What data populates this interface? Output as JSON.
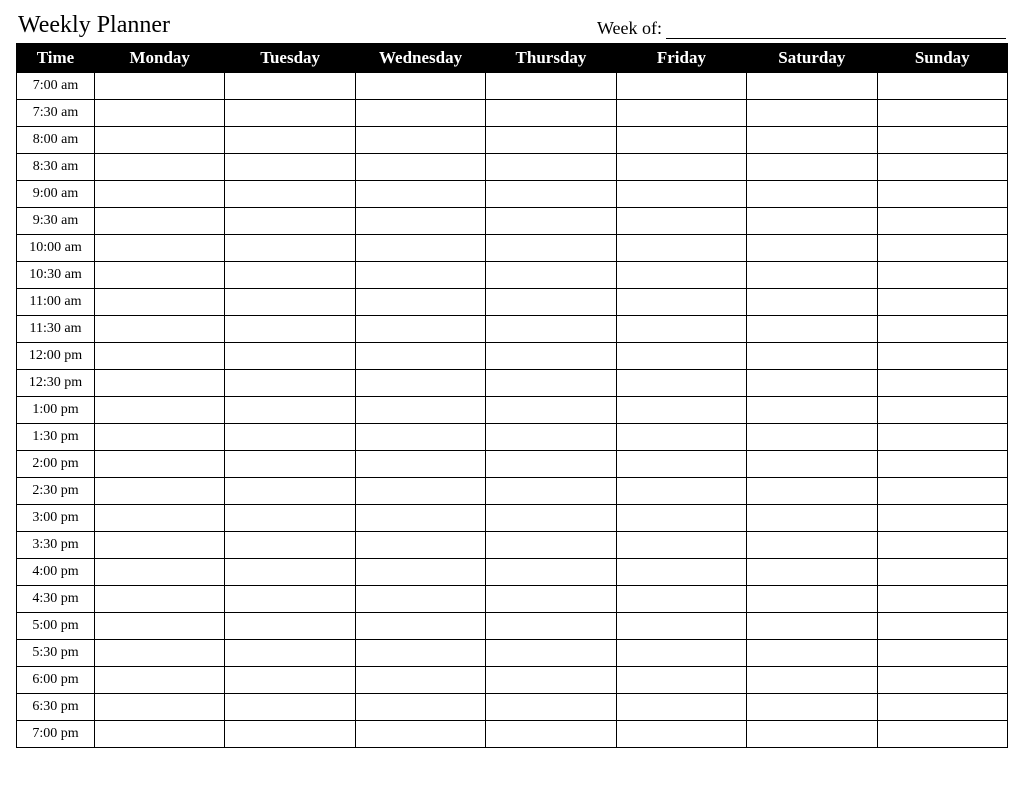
{
  "header": {
    "title": "Weekly Planner",
    "week_of_label": "Week of:"
  },
  "columns": {
    "time": "Time",
    "days": [
      "Monday",
      "Tuesday",
      "Wednesday",
      "Thursday",
      "Friday",
      "Saturday",
      "Sunday"
    ]
  },
  "time_slots": [
    "7:00 am",
    "7:30 am",
    "8:00 am",
    "8:30 am",
    "9:00 am",
    "9:30 am",
    "10:00 am",
    "10:30 am",
    "11:00 am",
    "11:30 am",
    "12:00 pm",
    "12:30 pm",
    "1:00 pm",
    "1:30 pm",
    "2:00 pm",
    "2:30 pm",
    "3:00 pm",
    "3:30 pm",
    "4:00 pm",
    "4:30 pm",
    "5:00 pm",
    "5:30 pm",
    "6:00 pm",
    "6:30 pm",
    "7:00 pm"
  ]
}
